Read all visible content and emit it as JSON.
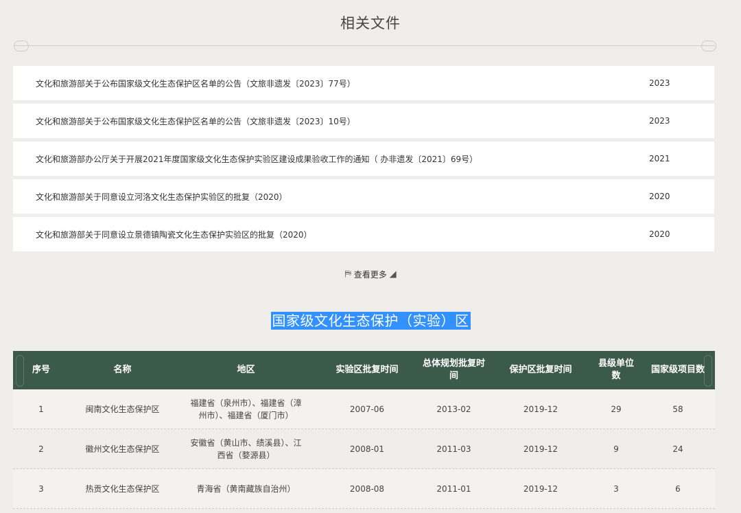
{
  "related": {
    "title": "相关文件",
    "items": [
      {
        "title": "文化和旅游部关于公布国家级文化生态保护区名单的公告（文旅非遗发〔2023〕77号）",
        "year": "2023"
      },
      {
        "title": "文化和旅游部关于公布国家级文化生态保护区名单的公告（文旅非遗发〔2023〕10号）",
        "year": "2023"
      },
      {
        "title": "文化和旅游部办公厅关于开展2021年度国家级文化生态保护实验区建设成果验收工作的通知（ 办非遗发〔2021〕69号）",
        "year": "2021"
      },
      {
        "title": "文化和旅游部关于同意设立河洛文化生态保护实验区的批复（2020）",
        "year": "2020"
      },
      {
        "title": "文化和旅游部关于同意设立景德镇陶瓷文化生态保护实验区的批复（2020）",
        "year": "2020"
      }
    ],
    "more_label": "查看更多"
  },
  "zones": {
    "title": "国家级文化生态保护（实验）区",
    "headers": [
      "序号",
      "名称",
      "地区",
      "实验区批复时间",
      "总体规划批复时间",
      "保护区批复时间",
      "县级单位数",
      "国家级项目数"
    ],
    "rows": [
      [
        "1",
        "闽南文化生态保护区",
        "福建省（泉州市）、福建省（漳州市）、福建省（厦门市）",
        "2007-06",
        "2013-02",
        "2019-12",
        "29",
        "58"
      ],
      [
        "2",
        "徽州文化生态保护区",
        "安徽省（黄山市、绩溪县）、江西省（婺源县）",
        "2008-01",
        "2011-03",
        "2019-12",
        "9",
        "24"
      ],
      [
        "3",
        "热贡文化生态保护区",
        "青海省（黄南藏族自治州）",
        "2008-08",
        "2011-01",
        "2019-12",
        "3",
        "6"
      ]
    ]
  },
  "colors": {
    "header_bg": "#3c5a4a",
    "selection": "#3390ff",
    "page_bg": "#efeeea"
  }
}
